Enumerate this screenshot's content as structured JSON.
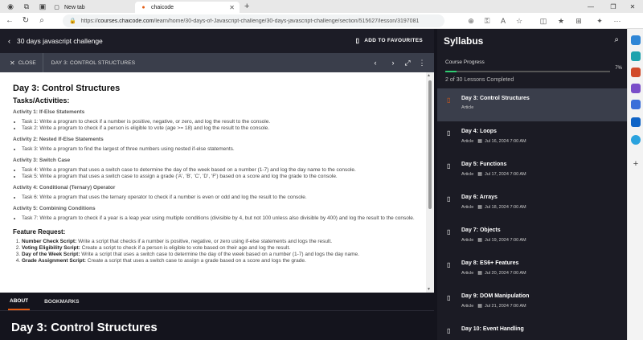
{
  "browser": {
    "tabs": [
      {
        "title": "New tab",
        "active": false
      },
      {
        "title": "chaicode",
        "active": true
      }
    ],
    "url_prefix": "https://",
    "url_host": "courses.chaicode.com",
    "url_path": "/learn/home/30-days-of-Javascript-challenge/30-days-javascript-challenge/section/515627/lesson/3197081"
  },
  "header": {
    "course_title": "30 days javascript challenge",
    "add_fav": "ADD TO FAVOURITES"
  },
  "lesson_bar": {
    "close": "CLOSE",
    "day_label": "DAY 3: CONTROL STRUCTURES"
  },
  "doc": {
    "title": "Day 3: Control Structures",
    "tasks_heading": "Tasks/Activities:",
    "activities": [
      {
        "heading": "Activity 1: If-Else Statements",
        "tasks": [
          "Task 1: Write a program to check if a number is positive, negative, or zero, and log the result to the console.",
          "Task 2: Write a program to check if a person is eligible to vote (age >= 18) and log the result to the console."
        ]
      },
      {
        "heading": "Activity 2: Nested If-Else Statements",
        "tasks": [
          "Task 3: Write a program to find the largest of three numbers using nested if-else statements."
        ]
      },
      {
        "heading": "Activity 3: Switch Case",
        "tasks": [
          "Task 4: Write a program that uses a switch case to determine the day of the week based on a number (1-7) and log the day name to the console.",
          "Task 5: Write a program that uses a switch case to assign a grade ('A', 'B', 'C', 'D', 'F') based on a score and log the grade to the console."
        ]
      },
      {
        "heading": "Activity 4: Conditional (Ternary) Operator",
        "tasks": [
          "Task 6: Write a program that uses the ternary operator to check if a number is even or odd and log the result to the console."
        ]
      },
      {
        "heading": "Activity 5: Combining Conditions",
        "tasks": [
          "Task 7: Write a program to check if a year is a leap year using multiple conditions (divisible by 4, but not 100 unless also divisible by 400) and log the result to the console."
        ]
      }
    ],
    "feature_heading": "Feature Request:",
    "features": [
      {
        "name": "Number Check Script:",
        "text": " Write a script that checks if a number is positive, negative, or zero using if-else statements and logs the result."
      },
      {
        "name": "Voting Eligibility Script:",
        "text": " Create a script to check if a person is eligible to vote based on their age and log the result."
      },
      {
        "name": "Day of the Week Script:",
        "text": " Write a script that uses a switch case to determine the day of the week based on a number (1-7) and logs the day name."
      },
      {
        "name": "Grade Assignment Script:",
        "text": " Create a script that uses a switch case to assign a grade based on a score and logs the grade."
      }
    ]
  },
  "about": {
    "tab_about": "ABOUT",
    "tab_bookmarks": "BOOKMARKS",
    "title": "Day 3: Control Structures"
  },
  "syllabus": {
    "title": "Syllabus",
    "progress_label": "Course Progress",
    "progress_percent": "7%",
    "progress_fraction": 0.07,
    "lessons_completed": "2 of 30 Lessons Completed",
    "items": [
      {
        "title": "Day 3: Control Structures",
        "type": "Article",
        "date": "",
        "active": true
      },
      {
        "title": "Day 4: Loops",
        "type": "Article",
        "date": "Jul 16, 2024 7:00 AM",
        "active": false
      },
      {
        "title": "Day 5: Functions",
        "type": "Article",
        "date": "Jul 17, 2024 7:00 AM",
        "active": false
      },
      {
        "title": "Day 6: Arrays",
        "type": "Article",
        "date": "Jul 18, 2024 7:00 AM",
        "active": false
      },
      {
        "title": "Day 7: Objects",
        "type": "Article",
        "date": "Jul 19, 2024 7:00 AM",
        "active": false
      },
      {
        "title": "Day 8: ES6+ Features",
        "type": "Article",
        "date": "Jul 20, 2024 7:00 AM",
        "active": false
      },
      {
        "title": "Day 9: DOM Manipulation",
        "type": "Article",
        "date": "Jul 21, 2024 7:00 AM",
        "active": false
      },
      {
        "title": "Day 10: Event Handling",
        "type": "Article",
        "date": "",
        "active": false
      }
    ]
  }
}
